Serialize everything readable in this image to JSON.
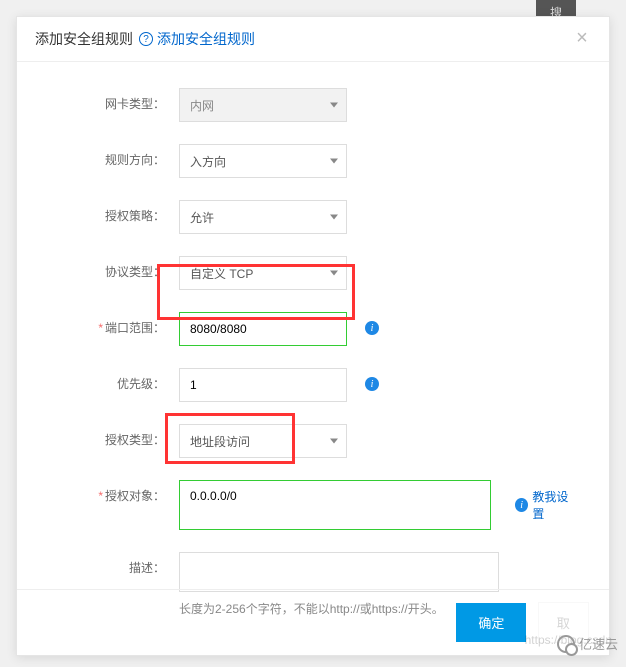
{
  "backdrop": {
    "search_tab": "搜"
  },
  "modal": {
    "title": "添加安全组规则",
    "help_link": "添加安全组规则"
  },
  "form": {
    "nic_type": {
      "label": "网卡类型：",
      "value": "内网"
    },
    "direction": {
      "label": "规则方向：",
      "value": "入方向"
    },
    "auth_policy": {
      "label": "授权策略：",
      "value": "允许"
    },
    "protocol": {
      "label": "协议类型：",
      "value": "自定义 TCP"
    },
    "port_range": {
      "label": "端口范围：",
      "value": "8080/8080"
    },
    "priority": {
      "label": "优先级：",
      "value": "1"
    },
    "auth_type": {
      "label": "授权类型：",
      "value": "地址段访问"
    },
    "auth_object": {
      "label": "授权对象：",
      "value": "0.0.0.0/0",
      "teach": "教我设置"
    },
    "description": {
      "label": "描述：",
      "value": "",
      "hint": "长度为2-256个字符，不能以http://或https://开头。"
    }
  },
  "footer": {
    "ok": "确定",
    "cancel": "取"
  },
  "watermark": "https://blog.csdn",
  "brand": "亿速云"
}
